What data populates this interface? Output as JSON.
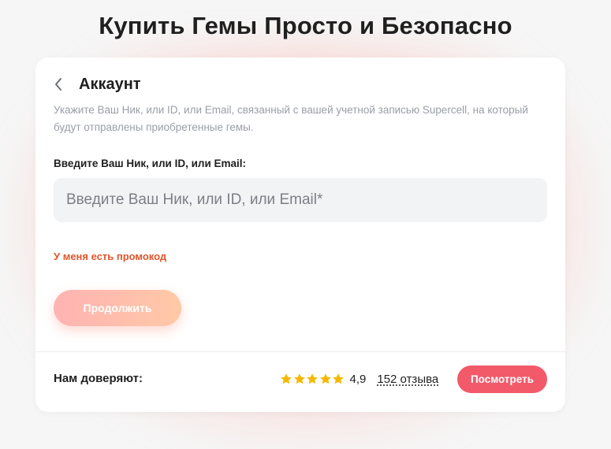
{
  "page": {
    "title": "Купить Гемы Просто и Безопасно"
  },
  "colors": {
    "accent": "#f25a6a",
    "promo": "#e0552b",
    "star": "#f5b800",
    "button_gradient_start": "#ffb3b3",
    "button_gradient_end": "#ffc9a6"
  },
  "card": {
    "back_icon": "chevron-left-icon",
    "title": "Аккаунт",
    "description": "Укажите Ваш Ник, или ID, или Email, связанный с вашей учетной записью Supercell, на который будут отправлены приобретенные гемы.",
    "field_label": "Введите Ваш Ник, или ID, или Email:",
    "input_value": "",
    "input_placeholder": "Введите Ваш Ник, или ID, или Email*",
    "promo_link": "У меня есть промокод",
    "continue_label": "Продолжить"
  },
  "trust": {
    "label": "Нам доверяют:",
    "stars": 5,
    "rating": "4,9",
    "reviews": "152 отзыва",
    "view_button": "Посмотреть"
  }
}
